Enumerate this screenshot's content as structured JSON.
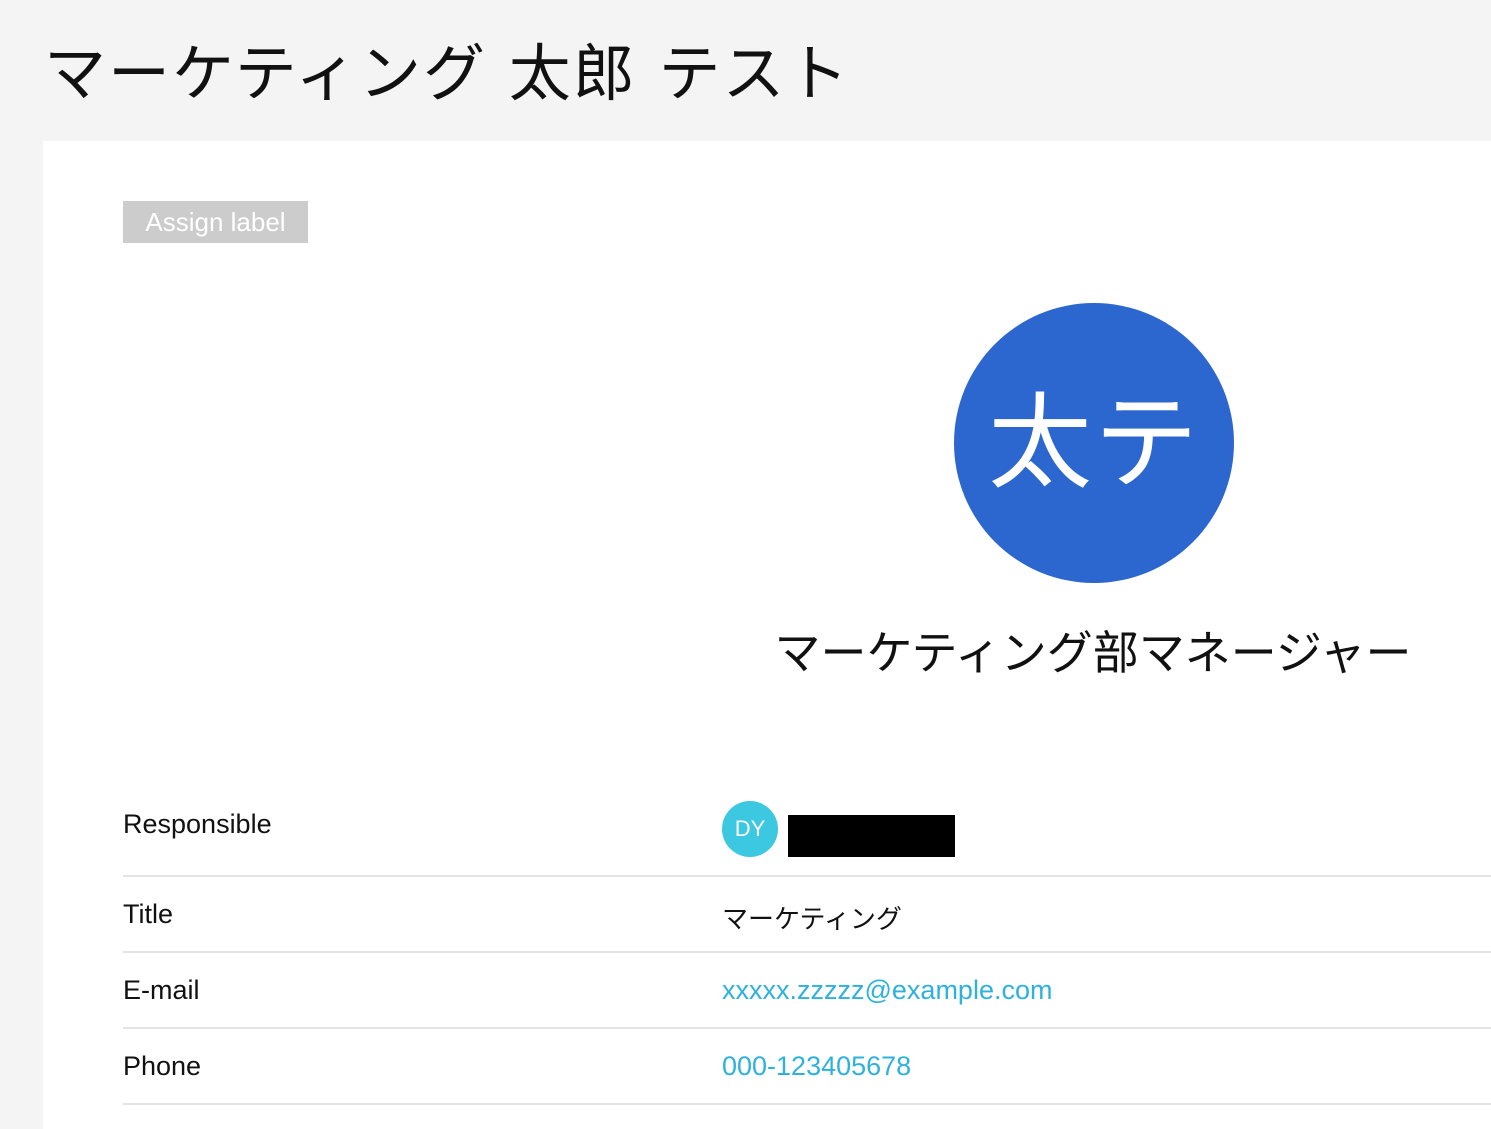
{
  "page": {
    "title": "マーケティング 太郎 テスト"
  },
  "label_button": "Assign label",
  "contact": {
    "avatar_initials": "太テ",
    "job_title": "マーケティング部マネージャー"
  },
  "details": {
    "responsible": {
      "label": "Responsible",
      "avatar_initials": "DY"
    },
    "title": {
      "label": "Title",
      "value": "マーケティング"
    },
    "email": {
      "label": "E-mail",
      "value": "xxxxx.zzzzz@example.com"
    },
    "phone": {
      "label": "Phone",
      "value": "000-123405678"
    }
  },
  "colors": {
    "avatar_large": "#2c66cf",
    "avatar_small": "#3cc8e0",
    "link": "#2eb2dd",
    "label_button_bg": "#cccccc",
    "page_bg": "#f4f4f4"
  }
}
